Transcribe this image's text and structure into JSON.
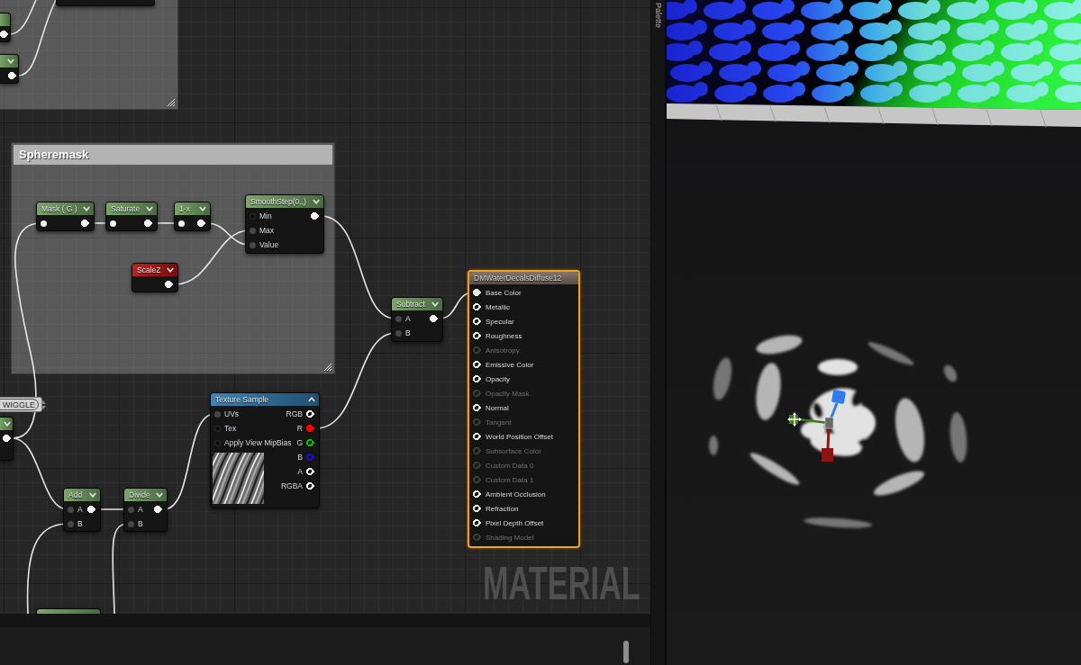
{
  "graph": {
    "comments": [
      {
        "header_visible": false
      },
      {
        "header_visible": true,
        "title": "Spheremask"
      }
    ],
    "nodes": [
      {
        "kind": "function",
        "selected": false
      },
      {
        "kind": "function",
        "selected": false,
        "outputs": [
          {
            "connected": true
          }
        ]
      },
      {
        "kind": "function",
        "expanded": false,
        "selected": false,
        "outputs": [
          {
            "connected": true
          }
        ]
      },
      {
        "kind": "function",
        "title": "Mask ( G )",
        "expanded": false,
        "selected": false,
        "inputs": [
          {
            "connected": true
          }
        ],
        "outputs": [
          {
            "connected": true
          }
        ]
      },
      {
        "kind": "function",
        "title": "Saturate",
        "expanded": false,
        "selected": false,
        "inputs": [
          {
            "connected": true
          }
        ],
        "outputs": [
          {
            "connected": true
          }
        ]
      },
      {
        "kind": "function",
        "title": "1-x",
        "expanded": false,
        "selected": false,
        "inputs": [
          {
            "connected": true
          }
        ],
        "outputs": [
          {
            "connected": true
          }
        ]
      },
      {
        "kind": "function",
        "title": "SmoothStep(0,,)",
        "expanded": false,
        "selected": false,
        "inputs": [
          {
            "label": "Min",
            "connected": false
          },
          {
            "label": "Max",
            "connected": true
          },
          {
            "label": "Value",
            "connected": true
          }
        ],
        "outputs": [
          {
            "connected": true
          }
        ]
      },
      {
        "kind": "parameter",
        "title": "ScaleZ",
        "expanded": false,
        "selected": false,
        "outputs": [
          {
            "connected": true
          }
        ]
      },
      {
        "kind": "function",
        "title": "Subtract",
        "expanded": false,
        "selected": false,
        "inputs": [
          {
            "label": "A",
            "connected": true
          },
          {
            "label": "B",
            "connected": true
          }
        ],
        "outputs": [
          {
            "connected": true
          }
        ]
      },
      {
        "kind": "result",
        "title": "DMWaterDecalsDiffuse12",
        "selected": true,
        "inputs": [
          {
            "label": "Base Color",
            "connected": true,
            "disabled": false
          },
          {
            "label": "Metallic",
            "connected": false,
            "disabled": false
          },
          {
            "label": "Specular",
            "connected": false,
            "disabled": false
          },
          {
            "label": "Roughness",
            "connected": false,
            "disabled": false
          },
          {
            "label": "Anisotropy",
            "connected": false,
            "disabled": true
          },
          {
            "label": "Emissive Color",
            "connected": false,
            "disabled": false
          },
          {
            "label": "Opacity",
            "connected": false,
            "disabled": false
          },
          {
            "label": "Opacity Mask",
            "connected": false,
            "disabled": true
          },
          {
            "label": "Normal",
            "connected": false,
            "disabled": false
          },
          {
            "label": "Tangent",
            "connected": false,
            "disabled": true
          },
          {
            "label": "World Position Offset",
            "connected": false,
            "disabled": false
          },
          {
            "label": "Subsurface Color",
            "connected": false,
            "disabled": true
          },
          {
            "label": "Custom Data 0",
            "connected": false,
            "disabled": true
          },
          {
            "label": "Custom Data 1",
            "connected": false,
            "disabled": true
          },
          {
            "label": "Ambient Occlusion",
            "connected": false,
            "disabled": false
          },
          {
            "label": "Refraction",
            "connected": false,
            "disabled": false
          },
          {
            "label": "Pixel Depth Offset",
            "connected": false,
            "disabled": false
          },
          {
            "label": "Shading Model",
            "connected": false,
            "disabled": true
          }
        ]
      },
      {
        "kind": "texture",
        "title": "Texture Sample",
        "expanded": true,
        "selected": false,
        "inputs": [
          {
            "label": "UVs",
            "connected": true
          },
          {
            "label": "Tex",
            "connected": false
          },
          {
            "label": "Apply View MipBias",
            "connected": false
          }
        ],
        "outputs": [
          {
            "label": "RGB",
            "connected": false,
            "color": "#ffffff"
          },
          {
            "label": "R",
            "connected": true,
            "color": "#ff0000"
          },
          {
            "label": "G",
            "connected": false,
            "color": "#00c000"
          },
          {
            "label": "B",
            "connected": false,
            "color": "#1010c8"
          },
          {
            "label": "A",
            "connected": false,
            "color": "#ffffff"
          },
          {
            "label": "RGBA",
            "connected": false,
            "color": "#ffffff"
          }
        ]
      },
      {
        "kind": "function",
        "expanded": false,
        "selected": false,
        "outputs": [
          {
            "connected": true
          }
        ]
      },
      {
        "kind": "function",
        "title": "Add",
        "expanded": false,
        "selected": false,
        "inputs": [
          {
            "label": "A",
            "connected": true
          },
          {
            "label": "B",
            "connected": true
          }
        ],
        "outputs": [
          {
            "connected": true
          }
        ]
      },
      {
        "kind": "function",
        "title": "Divide",
        "expanded": false,
        "selected": false,
        "inputs": [
          {
            "label": "A",
            "connected": true
          },
          {
            "label": "B",
            "connected": true
          }
        ],
        "outputs": [
          {
            "connected": true
          }
        ]
      },
      {
        "kind": "function",
        "selected": false
      }
    ],
    "named_reroute": {
      "label": "WIGGLE"
    },
    "graph_label": "MATERIAL"
  },
  "palette_tab": {
    "label": "Palette"
  }
}
